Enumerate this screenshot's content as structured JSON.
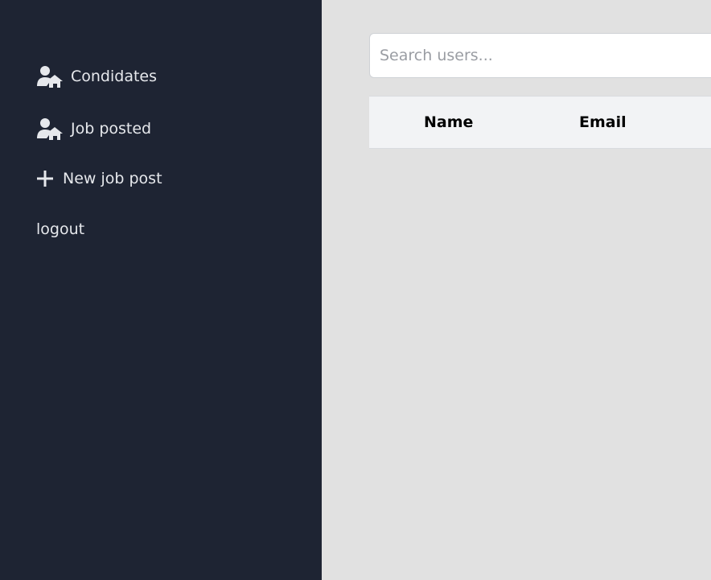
{
  "colors": {
    "sidebar_bg": "#1e2433",
    "sidebar_text": "#e6e8ec",
    "main_bg": "#e1e1e1",
    "table_header_bg": "#f2f3f5"
  },
  "sidebar": {
    "items": [
      {
        "label": "Condidates",
        "icon": "user-home-icon"
      },
      {
        "label": "Job posted",
        "icon": "user-home-icon"
      },
      {
        "label": "New job post",
        "icon": "plus-icon"
      },
      {
        "label": "logout"
      }
    ]
  },
  "search": {
    "placeholder": "Search users...",
    "value": ""
  },
  "table": {
    "headers": [
      "Name",
      "Email"
    ],
    "rows": []
  }
}
